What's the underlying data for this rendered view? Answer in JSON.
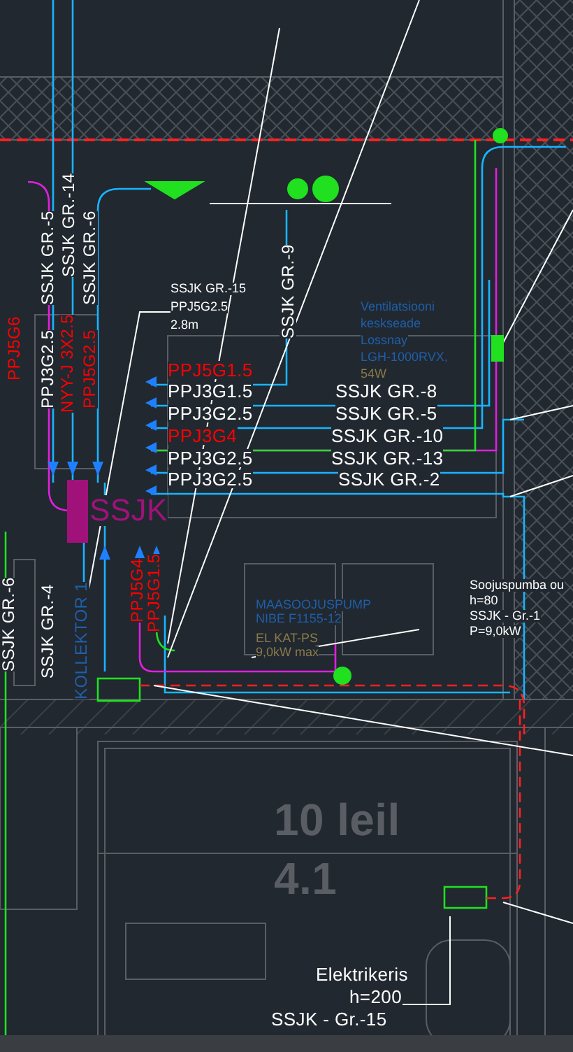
{
  "drawing": {
    "labels": [
      {
        "text": "SSJK GR.-5",
        "kind": "vertical",
        "color": "#ffffff"
      },
      {
        "text": "SSJK GR.-14",
        "kind": "vertical",
        "color": "#ffffff"
      },
      {
        "text": "SSJK GR.-6",
        "kind": "vertical",
        "color": "#ffffff"
      },
      {
        "text": "PPJ3G2.5",
        "kind": "vertical",
        "color": "#ffffff"
      },
      {
        "text": "NYY-J 3X2.5",
        "kind": "vertical",
        "color": "#ff0000"
      },
      {
        "text": "PPJ5G2.5",
        "kind": "vertical",
        "color": "#ff0000"
      },
      {
        "text": "PPJ5G6",
        "kind": "vertical",
        "color": "#ff0000"
      },
      {
        "text": "SSJK GR.-9",
        "kind": "vertical",
        "color": "#ffffff"
      },
      {
        "text": "SSJK GR.-15",
        "kind": "note",
        "color": "#ffffff"
      },
      {
        "text": "PPJ5G2.5",
        "kind": "note",
        "color": "#ffffff"
      },
      {
        "text": "2.8m",
        "kind": "note",
        "color": "#ffffff"
      },
      {
        "text": "Ventilatsiooni",
        "kind": "note",
        "color": "#1f5fa8"
      },
      {
        "text": "keskseade",
        "kind": "note",
        "color": "#1f5fa8"
      },
      {
        "text": "Lossnay",
        "kind": "note",
        "color": "#1f5fa8"
      },
      {
        "text": "LGH-1000RVX,",
        "kind": "note",
        "color": "#1f5fa8"
      },
      {
        "text": "54W",
        "kind": "note",
        "color": "#8a7a4a"
      },
      {
        "text": "PPJ5G1.5",
        "kind": "horizontal",
        "color": "#ff0000"
      },
      {
        "text": "PPJ3G1.5",
        "kind": "horizontal",
        "color": "#ffffff"
      },
      {
        "text": "PPJ3G2.5",
        "kind": "horizontal",
        "color": "#ffffff"
      },
      {
        "text": "PPJ3G4",
        "kind": "horizontal",
        "color": "#ff0000"
      },
      {
        "text": "PPJ3G2.5",
        "kind": "horizontal",
        "color": "#ffffff"
      },
      {
        "text": "PPJ3G2.5",
        "kind": "horizontal",
        "color": "#ffffff"
      },
      {
        "text": "SSJK GR.-8",
        "kind": "horizontal",
        "color": "#ffffff"
      },
      {
        "text": "SSJK GR.-5",
        "kind": "horizontal",
        "color": "#ffffff"
      },
      {
        "text": "SSJK GR.-10",
        "kind": "horizontal",
        "color": "#ffffff"
      },
      {
        "text": "SSJK GR.-13",
        "kind": "horizontal",
        "color": "#ffffff"
      },
      {
        "text": "SSJK GR.-2",
        "kind": "horizontal",
        "color": "#ffffff"
      },
      {
        "text": "SSJK GR.-4",
        "kind": "vertical",
        "color": "#ffffff"
      },
      {
        "text": "KOLLEKTOR 1",
        "kind": "vertical",
        "color": "#1f5fa8"
      },
      {
        "text": "PPJ5G4",
        "kind": "vertical",
        "color": "#ff0000"
      },
      {
        "text": "PPJ5G1.5",
        "kind": "vertical",
        "color": "#ff0000"
      },
      {
        "text": "SSJK GR.-6",
        "kind": "vertical",
        "color": "#ffffff"
      },
      {
        "text": "MAASOOJUSPUMP",
        "kind": "note",
        "color": "#1f5fa8"
      },
      {
        "text": "NIBE F1155-12",
        "kind": "note",
        "color": "#1f5fa8"
      },
      {
        "text": "EL KAT-PS",
        "kind": "note",
        "color": "#8a7a4a"
      },
      {
        "text": "9,0kW max",
        "kind": "note",
        "color": "#8a7a4a"
      },
      {
        "text": "Soojuspumba ou",
        "kind": "note",
        "color": "#ffffff"
      },
      {
        "text": "h=80",
        "kind": "note",
        "color": "#ffffff"
      },
      {
        "text": "SSJK - Gr.-1",
        "kind": "note",
        "color": "#ffffff"
      },
      {
        "text": "P=9,0kW",
        "kind": "note",
        "color": "#ffffff"
      },
      {
        "text": "10 leil",
        "kind": "room",
        "color": "#5a5e64"
      },
      {
        "text": "4.1",
        "kind": "room",
        "color": "#5a5e64"
      },
      {
        "text": "Elektrikeris",
        "kind": "horizontal",
        "color": "#ffffff"
      },
      {
        "text": "h=200",
        "kind": "horizontal",
        "color": "#ffffff"
      },
      {
        "text": "SSJK - Gr.-15",
        "kind": "horizontal",
        "color": "#ffffff"
      },
      {
        "text": "SSJK",
        "kind": "panel",
        "color": "#a0127a"
      }
    ]
  }
}
